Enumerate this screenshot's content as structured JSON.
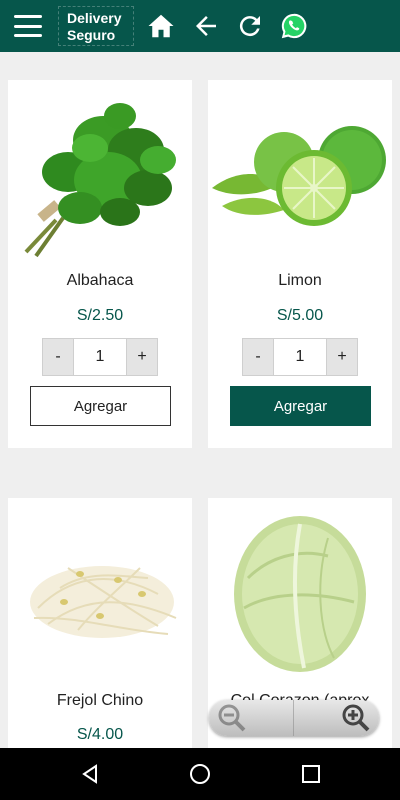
{
  "header": {
    "brand_line1": "Delivery",
    "brand_line2": "Seguro",
    "icons": [
      "menu-icon",
      "home-icon",
      "back-arrow-icon",
      "refresh-icon",
      "whatsapp-icon"
    ]
  },
  "products": [
    {
      "name": "Albahaca",
      "price": "S/2.50",
      "qty": "1",
      "minus": "-",
      "plus": "+",
      "button": "Agregar",
      "button_style": "outline"
    },
    {
      "name": "Limon",
      "price": "S/5.00",
      "qty": "1",
      "minus": "-",
      "plus": "+",
      "button": "Agregar",
      "button_style": "filled"
    },
    {
      "name": "Frejol Chino",
      "price": "S/4.00"
    },
    {
      "name": "Col Corazon (aprox"
    }
  ],
  "zoom": {
    "icons": [
      "zoom-out-icon",
      "zoom-in-icon"
    ]
  },
  "system_nav": {
    "icons": [
      "back-triangle-icon",
      "home-circle-icon",
      "recents-square-icon"
    ]
  },
  "colors": {
    "primary": "#06564b",
    "background": "#efefef",
    "card": "#ffffff"
  }
}
